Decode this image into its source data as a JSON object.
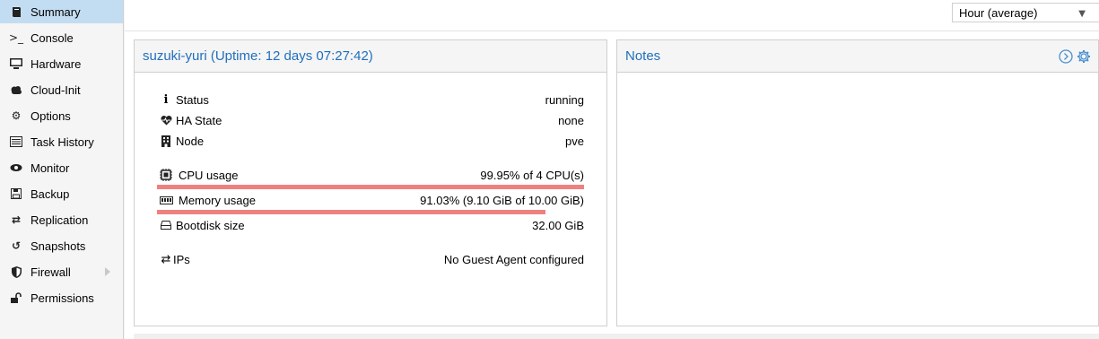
{
  "sidebar": {
    "items": [
      {
        "label": "Summary",
        "icon": "book-icon",
        "selected": true
      },
      {
        "label": "Console",
        "icon": "terminal-icon"
      },
      {
        "label": "Hardware",
        "icon": "desktop-icon"
      },
      {
        "label": "Cloud-Init",
        "icon": "cloud-icon"
      },
      {
        "label": "Options",
        "icon": "gear-icon"
      },
      {
        "label": "Task History",
        "icon": "list-icon"
      },
      {
        "label": "Monitor",
        "icon": "eye-icon"
      },
      {
        "label": "Backup",
        "icon": "floppy-icon"
      },
      {
        "label": "Replication",
        "icon": "retweet-icon"
      },
      {
        "label": "Snapshots",
        "icon": "history-icon"
      },
      {
        "label": "Firewall",
        "icon": "shield-icon",
        "has_submenu": true
      },
      {
        "label": "Permissions",
        "icon": "unlock-icon"
      }
    ]
  },
  "toolbar": {
    "timeframe": "Hour (average)"
  },
  "status": {
    "title": "suzuki-yuri (Uptime: 12 days 07:27:42)",
    "rows": {
      "status": {
        "label": "Status",
        "value": "running"
      },
      "ha": {
        "label": "HA State",
        "value": "none"
      },
      "node": {
        "label": "Node",
        "value": "pve"
      },
      "cpu": {
        "label": "CPU usage",
        "value": "99.95% of 4 CPU(s)",
        "fraction": 0.9995
      },
      "mem": {
        "label": "Memory usage",
        "value": "91.03% (9.10 GiB of 10.00 GiB)",
        "fraction": 0.9103
      },
      "disk": {
        "label": "Bootdisk size",
        "value": "32.00 GiB"
      },
      "ips": {
        "label": "IPs",
        "value": "No Guest Agent configured"
      }
    },
    "bar_color": "#f08080"
  },
  "notes": {
    "title": "Notes"
  },
  "colors": {
    "accent": "#1f6fbd",
    "selected": "#c2ddf2"
  }
}
